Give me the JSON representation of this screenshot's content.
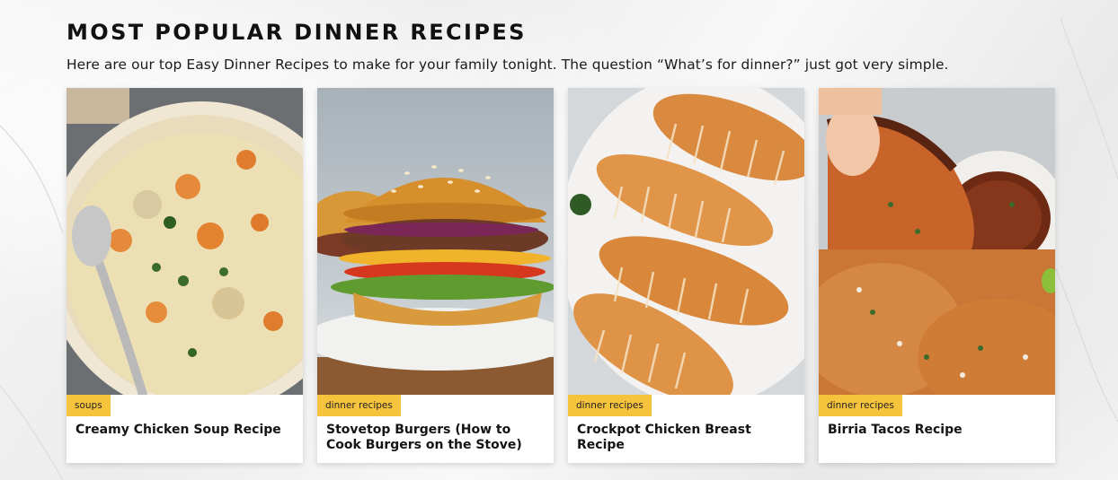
{
  "section": {
    "heading": "MOST POPULAR DINNER RECIPES",
    "intro": "Here are our top Easy Dinner Recipes to make for your family tonight. The question “What’s for dinner?” just got very simple."
  },
  "recipes": [
    {
      "category": "soups",
      "title": "Creamy Chicken Soup Recipe"
    },
    {
      "category": "dinner recipes",
      "title": "Stovetop Burgers (How to Cook Burgers on the Stove)"
    },
    {
      "category": "dinner recipes",
      "title": "Crockpot Chicken Breast Recipe"
    },
    {
      "category": "dinner recipes",
      "title": "Birria Tacos Recipe"
    }
  ],
  "colors": {
    "badge": "#f6c43c",
    "text": "#141414",
    "card": "#ffffff"
  }
}
